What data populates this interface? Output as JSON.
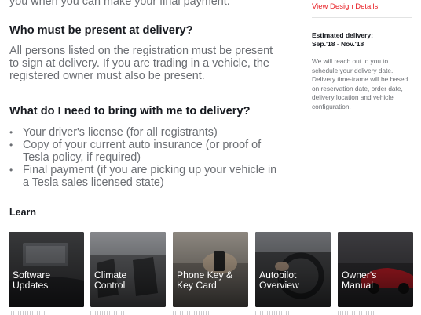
{
  "intro_line": "you when you can make your final payment.",
  "q_present": "Who must be present at delivery?",
  "a_present": "All persons listed on the registration must be present to sign at delivery. If you are trading in a vehicle, the registered owner must also be present.",
  "q_bring": "What do I need to bring with me to delivery?",
  "bring_items": [
    "Your driver's license (for all registrants)",
    "Copy of your current auto insurance (or proof of Tesla policy, if required)",
    "Final payment (if you are picking up your vehicle in a Tesla sales licensed state)"
  ],
  "sidebar": {
    "design_link": "View Design Details",
    "delivery_label": "Estimated delivery:",
    "delivery_value": "Sep.'18 - Nov.'18",
    "delivery_desc": "We will reach out to you to schedule your delivery date. Delivery time-frame will be based on reservation date, order date, delivery location and vehicle configuration."
  },
  "learn": {
    "title": "Learn",
    "cards": [
      {
        "title_line1": "Software",
        "title_line2": "Updates",
        "image": "car-interior-screen",
        "bg": "#3a3b3d"
      },
      {
        "title_line1": "Climate",
        "title_line2": "Control",
        "image": "car-seats-interior",
        "bg": "#4a4b4e"
      },
      {
        "title_line1": "Phone Key &",
        "title_line2": "Key Card",
        "image": "hand-with-phone",
        "bg": "#6b6660"
      },
      {
        "title_line1": "Autopilot",
        "title_line2": "Overview",
        "image": "driver-hands-wheel",
        "bg": "#3c3d3f"
      },
      {
        "title_line1": "Owner's",
        "title_line2": "Manual",
        "image": "red-car-side",
        "bg": "#2b2a2d"
      }
    ]
  }
}
